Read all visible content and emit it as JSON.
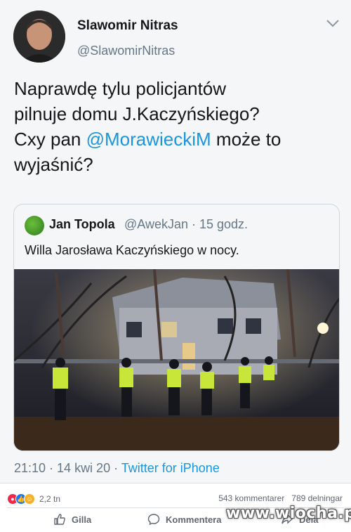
{
  "tweet": {
    "author_name": "Slawomir Nitras",
    "author_handle": "@SlawomirNitras",
    "text_line1": "Naprawdę tylu policjantów",
    "text_line2": "pilnuje domu J.Kaczyńskiego?",
    "text_line3_before": "Cxy pan ",
    "text_line3_mention": "@MorawieckiM",
    "text_line3_after": " może to",
    "text_line4": "wyjaśnić?",
    "time": "21:10 · 14 kwi 20 · ",
    "source": "Twitter for iPhone"
  },
  "quote": {
    "author_name": "Jan Topola",
    "author_handle": "@AwekJan · 15 godz.",
    "text": "Willa Jarosława Kaczyńskiego w nocy."
  },
  "facebook": {
    "reaction_count": "2,2 tn",
    "comments": "543 kommentarer",
    "shares": "789 delningar",
    "like_label": "Gilla",
    "comment_label": "Kommentera",
    "share_label": "Dela",
    "reaction_colors": [
      "#f0284a",
      "#1877f2",
      "#f7b125"
    ]
  },
  "watermark": "www.wiocha.pl",
  "icons": [
    "chevron-down-icon",
    "thumbs-up-icon",
    "comment-icon",
    "share-icon"
  ]
}
